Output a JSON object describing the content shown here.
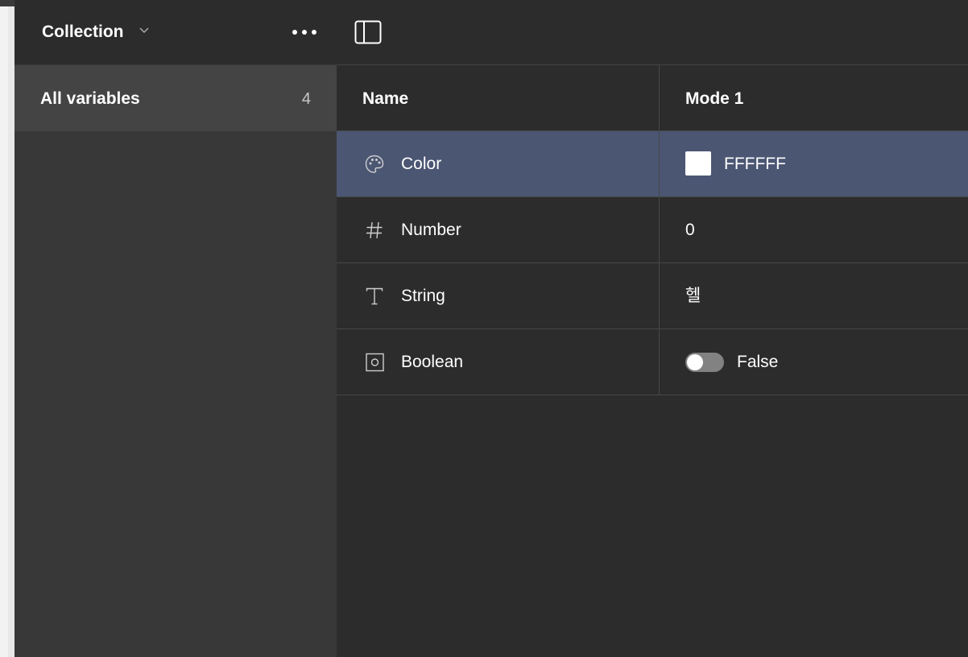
{
  "sidebar": {
    "collection_title": "Collection",
    "collection_chevron_icon": "chevron-down-icon",
    "more_icon": "more-horizontal-icon",
    "all_variables": {
      "label": "All variables",
      "count": "4"
    }
  },
  "toolbar": {
    "panel_icon": "sidebar-toggle-icon"
  },
  "table": {
    "columns": [
      "Name",
      "Mode 1"
    ],
    "rows": [
      {
        "icon": "palette-icon",
        "name": "Color",
        "value": "FFFFFF",
        "swatch_color": "#FFFFFF",
        "selected": true
      },
      {
        "icon": "hash-icon",
        "name": "Number",
        "value": "0"
      },
      {
        "icon": "text-type-icon",
        "name": "String",
        "value": "헬"
      },
      {
        "icon": "boolean-icon",
        "name": "Boolean",
        "value": "False",
        "toggle_on": false
      }
    ]
  },
  "colors": {
    "selection": "#4B5673",
    "sidebar_bg": "#383838",
    "main_bg": "#2C2C2C"
  }
}
